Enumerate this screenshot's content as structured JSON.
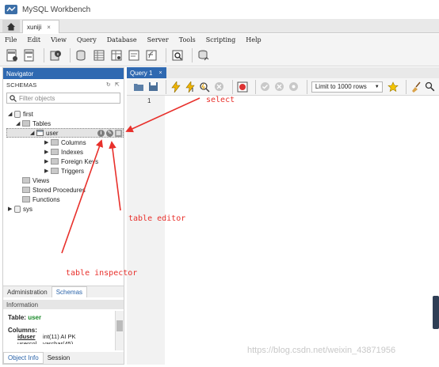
{
  "window": {
    "title": "MySQL Workbench"
  },
  "tabs": {
    "connection_label": "xuniji",
    "close_glyph": "×"
  },
  "menu": [
    "File",
    "Edit",
    "View",
    "Query",
    "Database",
    "Server",
    "Tools",
    "Scripting",
    "Help"
  ],
  "navigator": {
    "header": "Navigator",
    "schemas_label": "SCHEMAS",
    "filter_placeholder": "Filter objects",
    "tree": {
      "first": "first",
      "tables": "Tables",
      "user": "user",
      "columns": "Columns",
      "indexes": "Indexes",
      "foreign_keys": "Foreign Keys",
      "triggers": "Triggers",
      "views": "Views",
      "stored_procedures": "Stored Procedures",
      "functions": "Functions",
      "sys": "sys"
    },
    "hover_icons": [
      "info-icon",
      "wrench-icon",
      "table-grid-icon"
    ],
    "subtabs": {
      "administration": "Administration",
      "schemas": "Schemas"
    },
    "info": {
      "header": "Information",
      "table_label": "Table:",
      "table_name": "user",
      "columns_label": "Columns:",
      "col1_name": "iduser",
      "col1_type": "int(11) AI PK",
      "col2_name": "usercol",
      "col2_type": "varchar(45)"
    },
    "bottom_tabs": {
      "object_info": "Object Info",
      "session": "Session"
    }
  },
  "query": {
    "tab_label": "Query 1",
    "close_glyph": "×",
    "limit_label": "Limit to 1000 rows",
    "line_number": "1"
  },
  "annotations": {
    "select": "select",
    "table_editor": "table editor",
    "table_inspector": "table inspector"
  },
  "watermark": "https://blog.csdn.net/weixin_43871956",
  "colors": {
    "accent": "#2f69b1",
    "annotation": "#e8302b"
  }
}
